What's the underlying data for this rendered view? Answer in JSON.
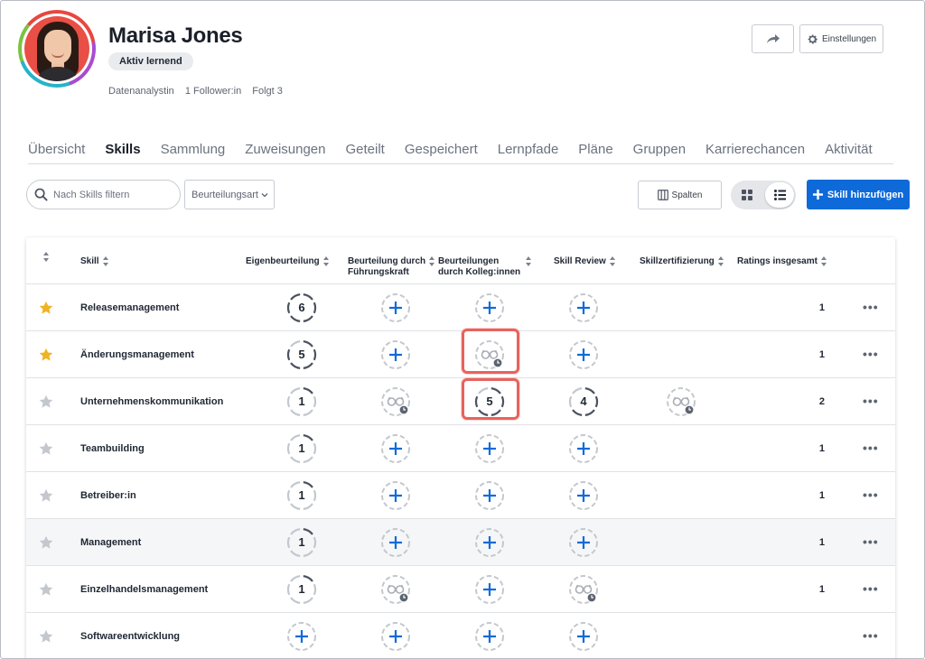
{
  "profile": {
    "name": "Marisa Jones",
    "status": "Aktiv lernend",
    "role": "Datenanalystin",
    "followers": "1 Follower:in",
    "following": "Folgt 3"
  },
  "header_actions": {
    "settings_label": "Einstellungen"
  },
  "tabs": [
    {
      "label": "Übersicht",
      "active": false
    },
    {
      "label": "Skills",
      "active": true
    },
    {
      "label": "Sammlung",
      "active": false
    },
    {
      "label": "Zuweisungen",
      "active": false
    },
    {
      "label": "Geteilt",
      "active": false
    },
    {
      "label": "Gespeichert",
      "active": false
    },
    {
      "label": "Lernpfade",
      "active": false
    },
    {
      "label": "Pläne",
      "active": false
    },
    {
      "label": "Gruppen",
      "active": false
    },
    {
      "label": "Karrierechancen",
      "active": false
    },
    {
      "label": "Aktivität",
      "active": false
    }
  ],
  "toolbar": {
    "search_placeholder": "Nach Skills filtern",
    "assessment_type": "Beurteilungsart",
    "columns_label": "Spalten",
    "add_skill_label": "Skill hinzufügen"
  },
  "table": {
    "headers": {
      "skill": "Skill",
      "self": "Eigenbeurteilung",
      "manager_1": "Beurteilung durch",
      "manager_2": "Führungskraft",
      "peers_1": "Beurteilungen",
      "peers_2": "durch Kolleg:innen",
      "review": "Skill Review",
      "cert": "Skillzertifizierung",
      "total": "Ratings insgesamt"
    },
    "rows": [
      {
        "skill": "Releasemanagement",
        "starred": true,
        "self": "6",
        "manager": "add",
        "peers": "add",
        "review": "add",
        "cert": "",
        "total": "1"
      },
      {
        "skill": "Änderungsmanagement",
        "starred": true,
        "self": "5",
        "manager": "add",
        "peers": "pending",
        "review": "add",
        "cert": "",
        "total": "1"
      },
      {
        "skill": "Unternehmenskommunikation",
        "starred": false,
        "self": "1",
        "manager": "pending",
        "peers": "5",
        "review": "4",
        "cert": "pending",
        "total": "2"
      },
      {
        "skill": "Teambuilding",
        "starred": false,
        "self": "1",
        "manager": "add",
        "peers": "add",
        "review": "add",
        "cert": "",
        "total": "1"
      },
      {
        "skill": "Betreiber:in",
        "starred": false,
        "self": "1",
        "manager": "add",
        "peers": "add",
        "review": "add",
        "cert": "",
        "total": "1"
      },
      {
        "skill": "Management",
        "starred": false,
        "self": "1",
        "manager": "add",
        "peers": "add",
        "review": "add",
        "cert": "",
        "total": "1"
      },
      {
        "skill": "Einzelhandelsmanagement",
        "starred": false,
        "self": "1",
        "manager": "pending",
        "peers": "add",
        "review": "pending",
        "cert": "",
        "total": "1"
      },
      {
        "skill": "Softwareentwicklung",
        "starred": false,
        "self": "add",
        "manager": "add",
        "peers": "add",
        "review": "add",
        "cert": "",
        "total": ""
      }
    ]
  },
  "colors": {
    "accent": "#0f6ad9",
    "star_active": "#f0b323",
    "star_inactive": "#c4c8ce",
    "highlight": "#e8635b"
  }
}
